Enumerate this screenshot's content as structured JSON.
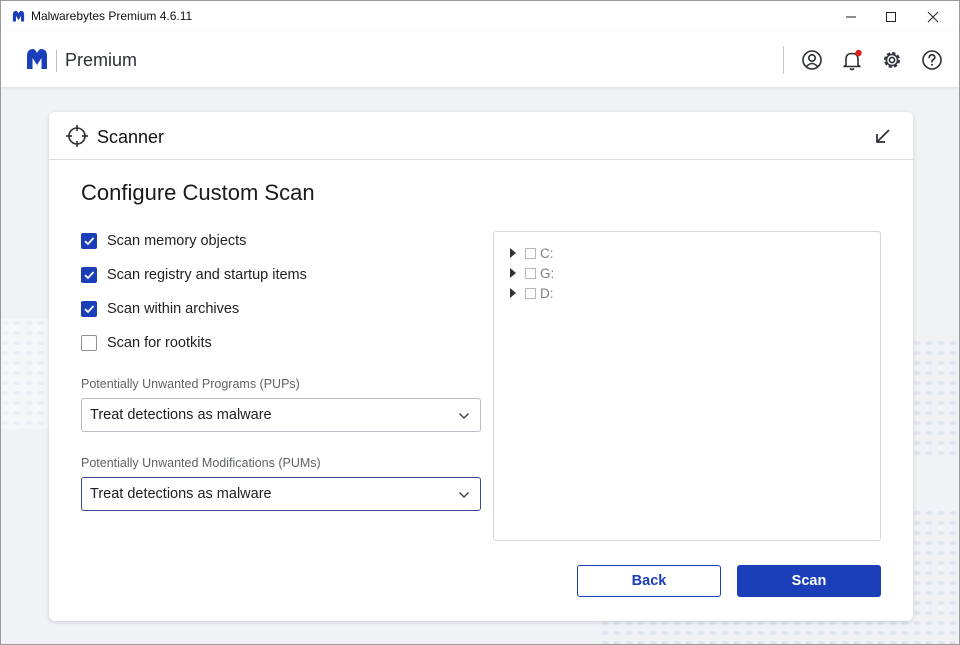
{
  "window": {
    "title": "Malwarebytes Premium 4.6.11",
    "accent_color": "#1a3fb8",
    "controls": [
      "minimize-icon",
      "maximize-icon",
      "close-icon"
    ]
  },
  "header": {
    "product": "Premium",
    "icons": [
      "account-icon",
      "notifications-bell-icon",
      "settings-gear-icon",
      "help-icon"
    ],
    "notification_dot_color": "#e0211d"
  },
  "card": {
    "title": "Scanner",
    "heading": "Configure Custom Scan"
  },
  "options": [
    {
      "label": "Scan memory objects",
      "checked": true
    },
    {
      "label": "Scan registry and startup items",
      "checked": true
    },
    {
      "label": "Scan within archives",
      "checked": true
    },
    {
      "label": "Scan for rootkits",
      "checked": false
    }
  ],
  "pups": {
    "label": "Potentially Unwanted Programs (PUPs)",
    "value": "Treat detections as malware"
  },
  "pums": {
    "label": "Potentially Unwanted Modifications (PUMs)",
    "value": "Treat detections as malware"
  },
  "drives": [
    {
      "label": "C:",
      "checked": false
    },
    {
      "label": "G:",
      "checked": false
    },
    {
      "label": "D:",
      "checked": false
    }
  ],
  "buttons": {
    "back": "Back",
    "scan": "Scan"
  }
}
